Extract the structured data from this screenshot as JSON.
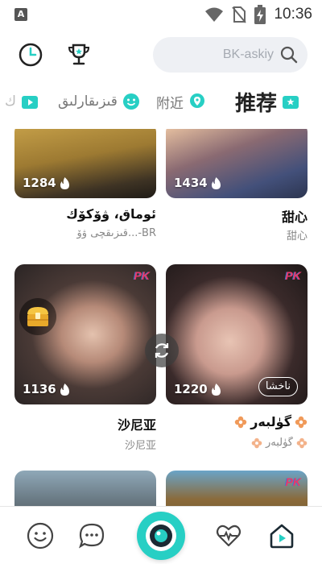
{
  "status_bar": {
    "app_badge": "A",
    "time": "10:36",
    "icons": [
      "wifi-icon",
      "no-sim-icon",
      "battery-charging-icon"
    ]
  },
  "header": {
    "search": {
      "placeholder": "BK-askiy",
      "icon": "search-icon"
    },
    "icons": [
      "history-clock-icon",
      "trophy-icon"
    ]
  },
  "tabs": [
    {
      "label": "推荐",
      "active": true,
      "icon": "star-tv-icon"
    },
    {
      "label": "附近",
      "active": false,
      "icon": "location-pin-icon"
    },
    {
      "label": "قىزىقارلىق",
      "active": false,
      "icon": "smile-face-icon"
    },
    {
      "label": "ك",
      "active": false,
      "icon": "tv-icon"
    }
  ],
  "feed": {
    "cards": [
      {
        "count": "1434",
        "title": "甜心",
        "subtitle": "甜心"
      },
      {
        "count": "1284",
        "title": "ئوماق، ۋۆكۆك",
        "subtitle": "قىزىقچى ۋۆ...-BR"
      },
      {
        "count": "1220",
        "title": "گۈلبەر",
        "subtitle": "گۈلبەر",
        "badge": "ناخشا",
        "pk": "PK"
      },
      {
        "count": "1136",
        "title": "沙尼亚",
        "subtitle": "沙尼亚",
        "pk": "PK"
      },
      {
        "pk": "PK"
      },
      {}
    ]
  },
  "bottom_nav": {
    "items": [
      "smile-icon",
      "chat-bubble-icon",
      "camera-live-icon",
      "heartbeat-icon",
      "home-play-icon"
    ],
    "active": "home-play-icon",
    "accent": "#27cfc4"
  }
}
